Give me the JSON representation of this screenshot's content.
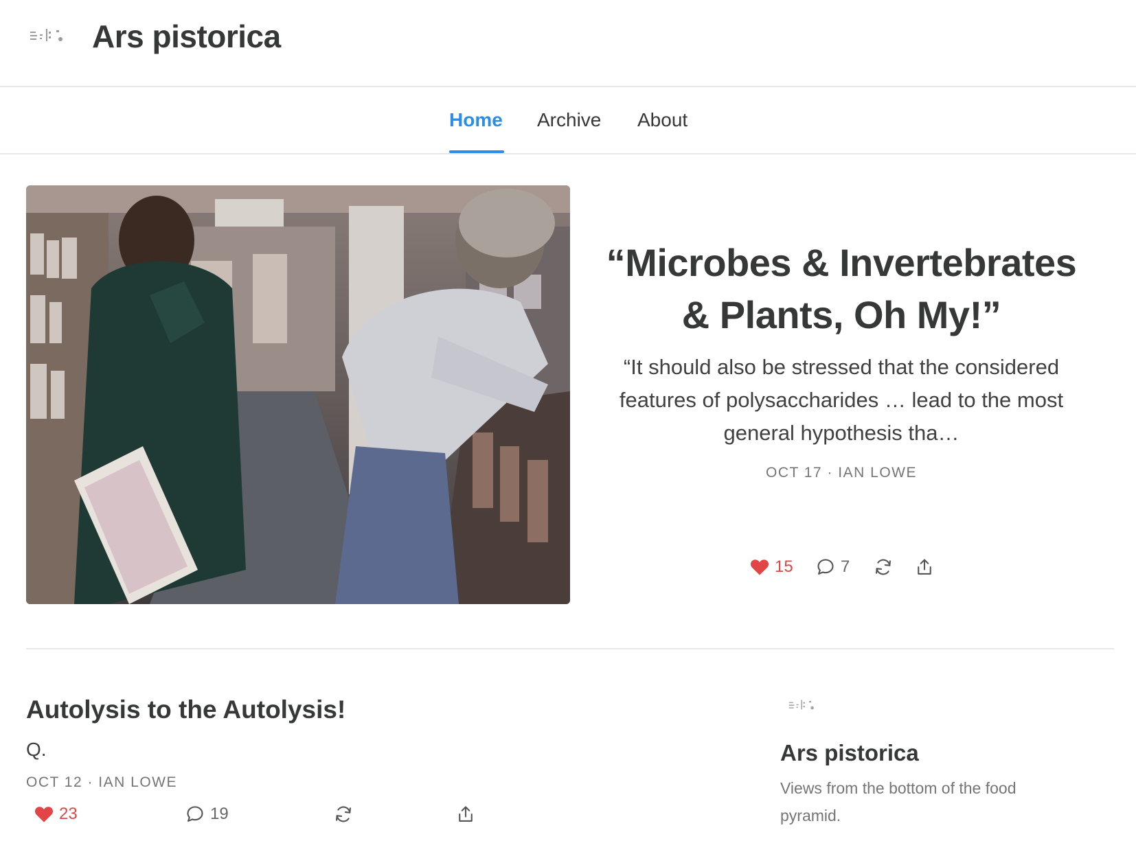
{
  "header": {
    "title": "Ars pistorica",
    "logo_icon": "publication-logo-icon"
  },
  "nav": {
    "items": [
      {
        "label": "Home",
        "active": true
      },
      {
        "label": "Archive"
      },
      {
        "label": "About"
      }
    ]
  },
  "featured": {
    "title": "“Microbes & Invertebrates & Plants, Oh My!”",
    "excerpt": "“It should also be stressed that the considered features of polysaccharides … lead to the most general hypothesis tha…",
    "meta": "OCT 17 · IAN LOWE",
    "likes": "15",
    "comments": "7"
  },
  "post": {
    "title": "Autolysis to the Autolysis!",
    "subtitle": "Q.",
    "meta": "OCT 12 · IAN LOWE",
    "likes": "23",
    "comments": "19"
  },
  "sidebar": {
    "title": "Ars pistorica",
    "description": "Views from the bottom of the food pyramid."
  },
  "colors": {
    "accent": "#2a8de8",
    "like": "#e24545",
    "text": "#363737",
    "muted": "#757575"
  }
}
